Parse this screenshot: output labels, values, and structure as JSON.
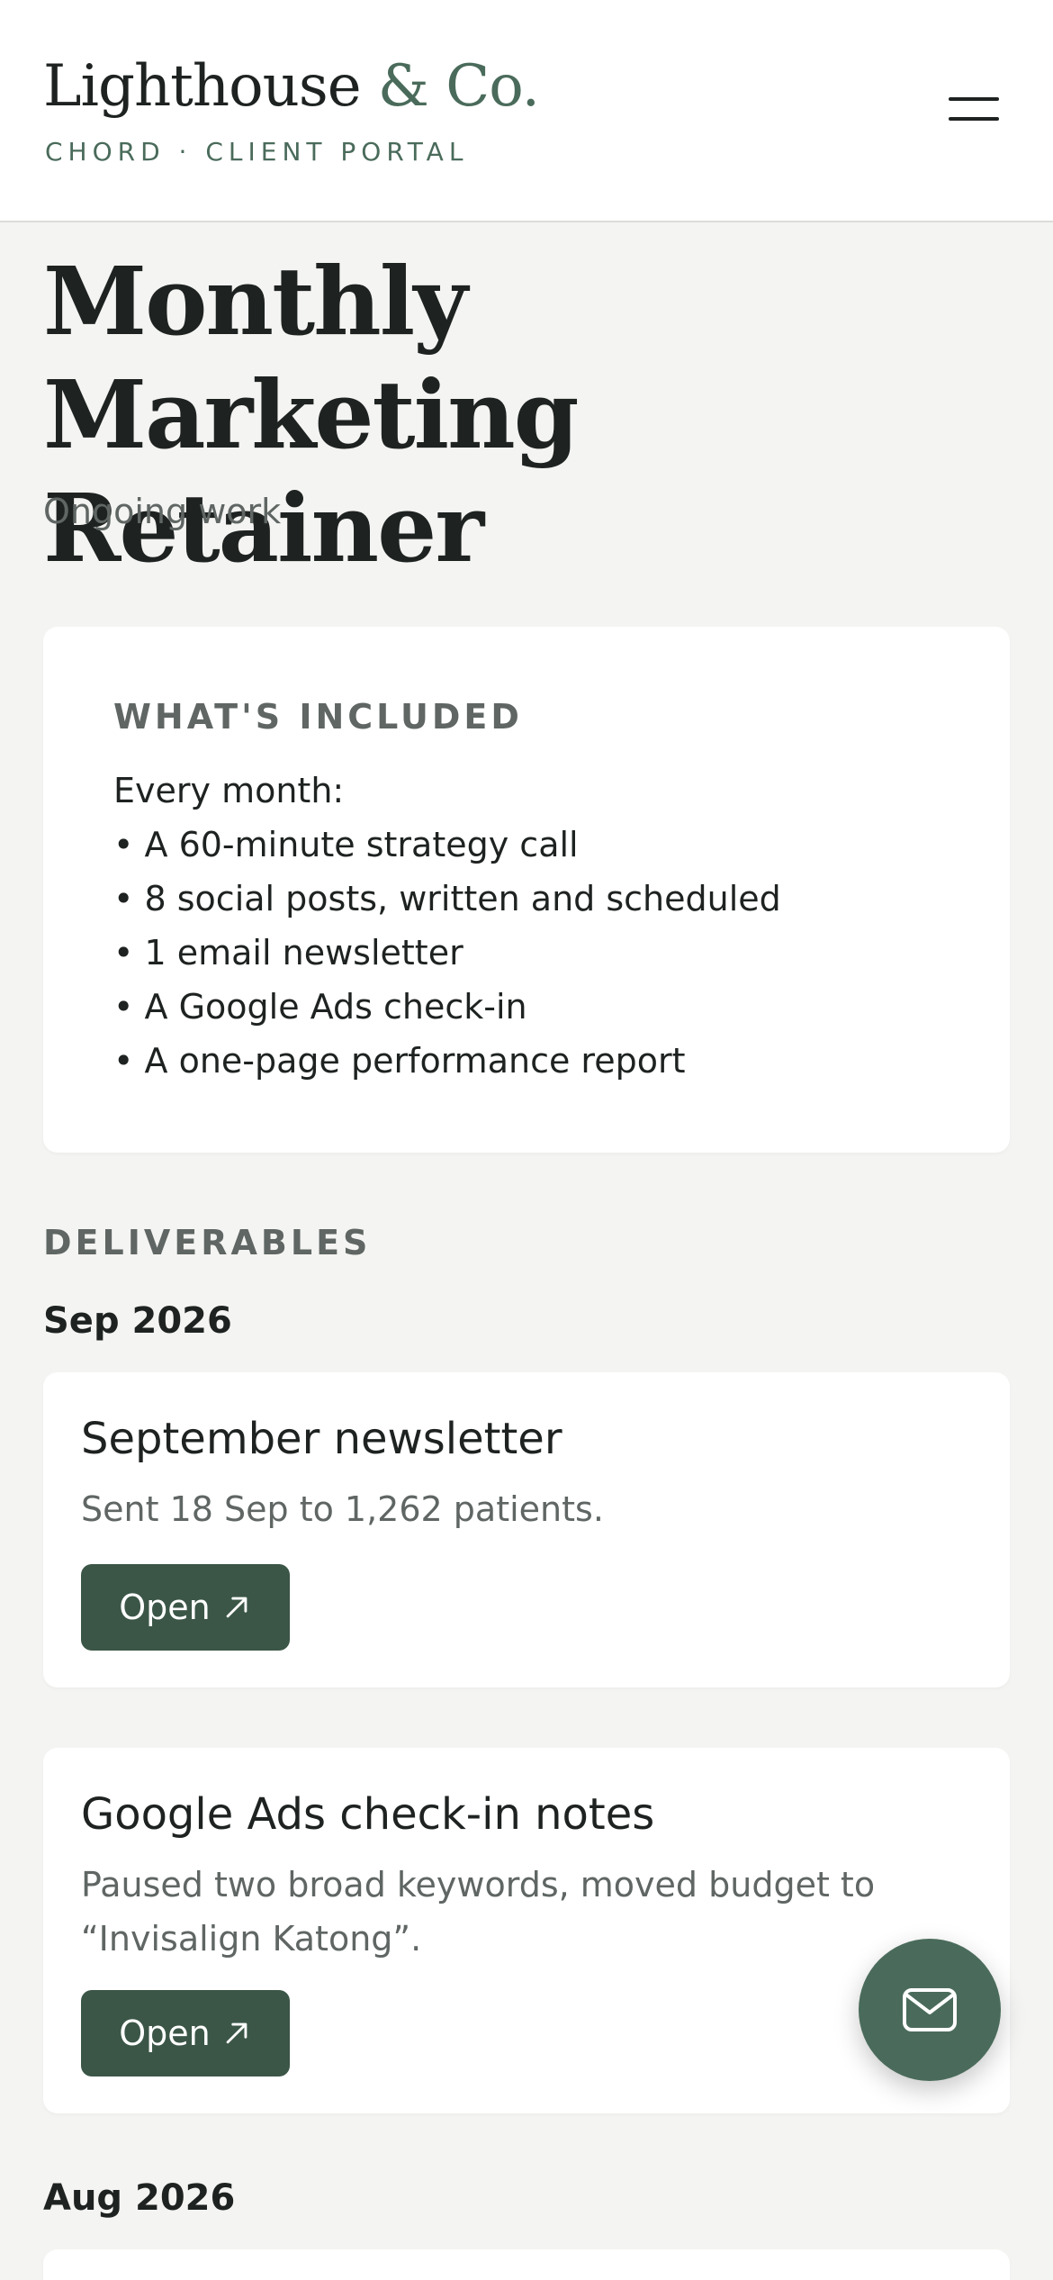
{
  "header": {
    "brand_name": "Lighthouse",
    "brand_amp": "&",
    "brand_suffix": "Co.",
    "subtitle": "CHORD · CLIENT PORTAL",
    "menu_icon": "hamburger-menu-icon"
  },
  "page": {
    "title": "Monthly Marketing Retainer",
    "subtitle": "Ongoing work"
  },
  "included": {
    "heading": "WHAT'S INCLUDED",
    "lines": [
      "Every month:",
      "• A 60-minute strategy call",
      "• 8 social posts, written and scheduled",
      "• 1 email newsletter",
      "• A Google Ads check-in",
      "• A one-page performance report"
    ]
  },
  "deliverables": {
    "heading": "DELIVERABLES",
    "months": [
      {
        "label": "Sep 2026",
        "items": [
          {
            "title": "September newsletter",
            "description": "Sent 18 Sep to 1,262 patients.",
            "button_label": "Open"
          },
          {
            "title": "Google Ads check-in notes",
            "description": "Paused two broad keywords, moved budget to “Invisalign Katong”.",
            "button_label": "Open"
          }
        ]
      },
      {
        "label": "Aug 2026",
        "items": []
      }
    ]
  },
  "fab": {
    "icon": "mail-icon"
  },
  "colors": {
    "accent": "#4a6b5b",
    "button": "#3b5647",
    "background": "#f4f4f2",
    "card": "#ffffff",
    "muted_text": "#5f6663"
  }
}
